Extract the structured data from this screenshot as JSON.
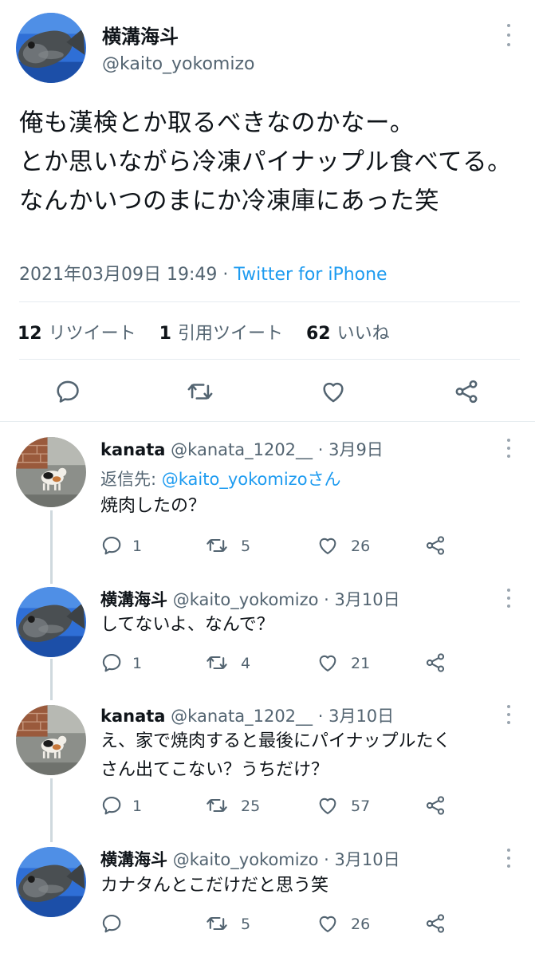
{
  "main_tweet": {
    "name": "横溝海斗",
    "handle": "@kaito_yokomizo",
    "text": "俺も漢検とか取るべきなのかなー。\nとか思いながら冷凍パイナップル食べてる。なんかいつのまにか冷凍庫にあった笑",
    "timestamp": "2021年03月09日 19:49",
    "separator": " · ",
    "source": "Twitter for iPhone",
    "retweets_count": "12",
    "retweets_label": "リツイート",
    "quotes_count": "1",
    "quotes_label": "引用ツイート",
    "likes_count": "62",
    "likes_label": "いいね"
  },
  "replies": [
    {
      "name": "kanata",
      "handle": "@kanata_1202__",
      "date": "3月9日",
      "reply_to_prefix": "返信先: ",
      "reply_to_user": "@kaito_yokomizoさん",
      "text": "焼肉したの？",
      "replies": "1",
      "retweets": "5",
      "likes": "26"
    },
    {
      "name": "横溝海斗",
      "handle": "@kaito_yokomizo",
      "date": "3月10日",
      "text": "してないよ、なんで？",
      "replies": "1",
      "retweets": "4",
      "likes": "21"
    },
    {
      "name": "kanata",
      "handle": "@kanata_1202__",
      "date": "3月10日",
      "text": "え、家で焼肉すると最後にパイナップルたく\nさん出てこない？うちだけ？",
      "replies": "1",
      "retweets": "25",
      "likes": "57"
    },
    {
      "name": "横溝海斗",
      "handle": "@kaito_yokomizo",
      "date": "3月10日",
      "text": "カナタんとこだけだと思う笑",
      "replies": "",
      "retweets": "5",
      "likes": "26"
    }
  ],
  "dot_separator": " · ",
  "colors": {
    "link": "#1d9bf0",
    "secondary": "#536471",
    "text": "#0f1419"
  },
  "icons": [
    "reply-icon",
    "retweet-icon",
    "like-icon",
    "share-icon",
    "more-icon"
  ]
}
